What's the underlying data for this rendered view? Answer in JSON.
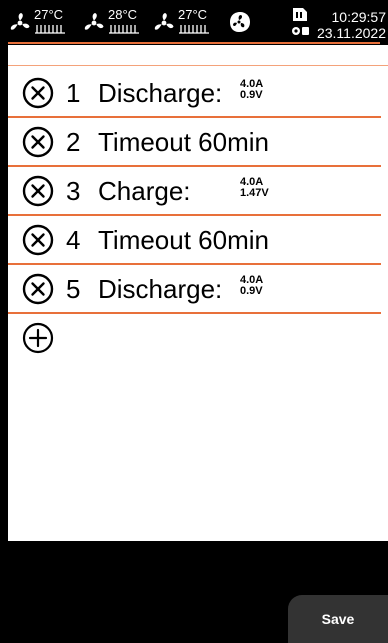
{
  "status_bar": {
    "sensors": [
      {
        "temperature": "27°C"
      },
      {
        "temperature": "28°C"
      },
      {
        "temperature": "27°C"
      }
    ],
    "time": "10:29:57",
    "date": "23.11.2022"
  },
  "steps": [
    {
      "number": "1",
      "label": "Discharge:",
      "current": "4.0A",
      "voltage": "0.9V"
    },
    {
      "number": "2",
      "label": "Timeout 60min"
    },
    {
      "number": "3",
      "label": "Charge:",
      "current": "4.0A",
      "voltage": "1.47V"
    },
    {
      "number": "4",
      "label": "Timeout 60min"
    },
    {
      "number": "5",
      "label": "Discharge:",
      "current": "4.0A",
      "voltage": "0.9V"
    }
  ],
  "save_label": "Save",
  "colors": {
    "accent": "#e8703a",
    "background": "#000000",
    "panel": "#ffffff",
    "button": "#333333"
  },
  "icons": {
    "fan": "fan-icon",
    "heater": "heater-icon",
    "remove": "remove-circle-icon",
    "add": "add-circle-icon",
    "storage": "storage-icon"
  }
}
